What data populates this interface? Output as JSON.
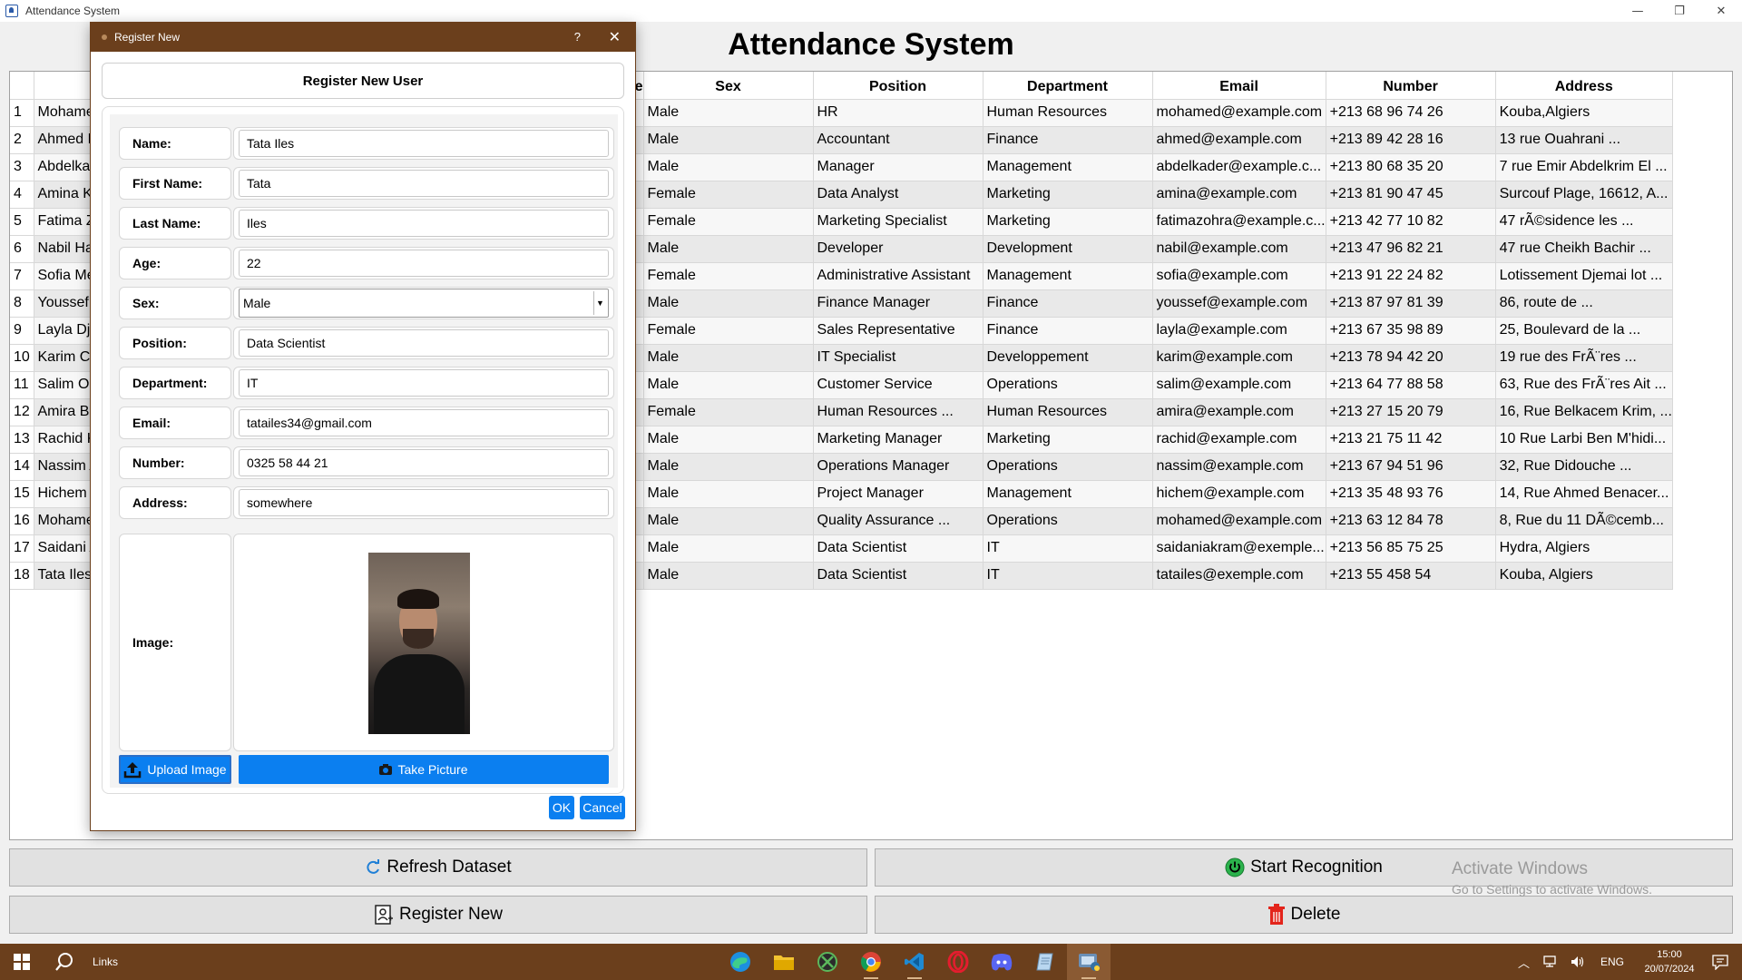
{
  "window": {
    "title": "Attendance System",
    "minimize": "—",
    "restore": "❐",
    "close": "✕"
  },
  "heading": "Attendance System",
  "table": {
    "columns": [
      "",
      "e",
      "Sex",
      "Position",
      "Department",
      "Email",
      "Number",
      "Address"
    ],
    "rows": [
      {
        "n": "1",
        "name": "Mohame",
        "sex": "Male",
        "position": "HR",
        "department": "Human Resources",
        "email": "mohamed@example.com",
        "number": "+213 68 96 74 26",
        "address": "Kouba,Algiers"
      },
      {
        "n": "2",
        "name": "Ahmed E",
        "sex": "Male",
        "position": "Accountant",
        "department": "Finance",
        "email": "ahmed@example.com",
        "number": "+213 89 42 28 16",
        "address": "13 rue Ouahrani ..."
      },
      {
        "n": "3",
        "name": "Abdelkac",
        "sex": "Male",
        "position": "Manager",
        "department": "Management",
        "email": "abdelkader@example.c...",
        "number": "+213 80 68 35 20",
        "address": "7 rue Emir Abdelkrim El ..."
      },
      {
        "n": "4",
        "name": "Amina K",
        "sex": "Female",
        "position": "Data Analyst",
        "department": "Marketing",
        "email": "amina@example.com",
        "number": "+213 81 90 47 45",
        "address": "Surcouf Plage, 16612, A..."
      },
      {
        "n": "5",
        "name": "Fatima Z",
        "sex": "Female",
        "position": "Marketing Specialist",
        "department": "Marketing",
        "email": "fatimazohra@example.c...",
        "number": "+213 42 77 10 82",
        "address": "47 rÃ©sidence les ..."
      },
      {
        "n": "6",
        "name": "Nabil Ha",
        "sex": "Male",
        "position": "Developer",
        "department": "Development",
        "email": "nabil@example.com",
        "number": "+213 47 96 82 21",
        "address": "47 rue Cheikh Bachir ..."
      },
      {
        "n": "7",
        "name": "Sofia Me",
        "sex": "Female",
        "position": "Administrative Assistant",
        "department": "Management",
        "email": "sofia@example.com",
        "number": "+213 91 22 24 82",
        "address": "Lotissement Djemai lot ..."
      },
      {
        "n": "8",
        "name": "Youssef I",
        "sex": "Male",
        "position": "Finance Manager",
        "department": "Finance",
        "email": "youssef@example.com",
        "number": "+213 87 97 81 39",
        "address": "86, route de ..."
      },
      {
        "n": "9",
        "name": "Layla Dje",
        "sex": "Female",
        "position": "Sales Representative",
        "department": "Finance",
        "email": "layla@example.com",
        "number": "+213 67 35 98 89",
        "address": "25, Boulevard de la ..."
      },
      {
        "n": "10",
        "name": "Karim Ch",
        "sex": "Male",
        "position": "IT Specialist",
        "department": "Developpement",
        "email": "karim@example.com",
        "number": "+213 78 94 42 20",
        "address": "19 rue des FrÃ¨res ..."
      },
      {
        "n": "11",
        "name": "Salim Ou",
        "sex": "Male",
        "position": "Customer Service",
        "department": "Operations",
        "email": "salim@example.com",
        "number": "+213 64 77 88 58",
        "address": "63, Rue des FrÃ¨res Ait ..."
      },
      {
        "n": "12",
        "name": "Amira Be",
        "sex": "Female",
        "position": "Human Resources ...",
        "department": "Human Resources",
        "email": "amira@example.com",
        "number": "+213 27 15 20 79",
        "address": "16, Rue Belkacem Krim, ..."
      },
      {
        "n": "13",
        "name": "Rachid K",
        "sex": "Male",
        "position": "Marketing Manager",
        "department": "Marketing",
        "email": "rachid@example.com",
        "number": "+213 21 75 11 42",
        "address": "10 Rue Larbi Ben M'hidi..."
      },
      {
        "n": "14",
        "name": "Nassim A",
        "sex": "Male",
        "position": "Operations Manager",
        "department": "Operations",
        "email": "nassim@example.com",
        "number": "+213 67 94 51 96",
        "address": "32, Rue Didouche ..."
      },
      {
        "n": "15",
        "name": "Hichem Z",
        "sex": "Male",
        "position": "Project Manager",
        "department": "Management",
        "email": "hichem@example.com",
        "number": "+213 35 48 93 76",
        "address": "14, Rue Ahmed Benacer..."
      },
      {
        "n": "16",
        "name": "Mohame",
        "sex": "Male",
        "position": "Quality Assurance ...",
        "department": "Operations",
        "email": "mohamed@example.com",
        "number": "+213 63 12 84 78",
        "address": "8, Rue du 11 DÃ©cemb..."
      },
      {
        "n": "17",
        "name": "Saidani A",
        "sex": "Male",
        "position": "Data Scientist",
        "department": "IT",
        "email": "saidaniakram@exemple...",
        "number": "+213 56 85 75 25",
        "address": "Hydra, Algiers"
      },
      {
        "n": "18",
        "name": "Tata Iles",
        "sex": "Male",
        "position": "Data Scientist",
        "department": "IT",
        "email": "tatailes@exemple.com",
        "number": "+213 55 458 54",
        "address": "Kouba, Algiers"
      }
    ]
  },
  "buttons": {
    "refresh": "Refresh Dataset",
    "start": "Start Recognition",
    "register": "Register New",
    "delete": "Delete"
  },
  "watermark": {
    "line1": "Activate Windows",
    "line2": "Go to Settings to activate Windows."
  },
  "dialog": {
    "title": "Register New",
    "help": "?",
    "close": "✕",
    "heading": "Register New User",
    "fields": {
      "name_label": "Name:",
      "name_value": "Tata Iles",
      "first_label": "First Name:",
      "first_value": "Tata",
      "last_label": "Last Name:",
      "last_value": "Iles",
      "age_label": "Age:",
      "age_value": "22",
      "sex_label": "Sex:",
      "sex_value": "Male",
      "position_label": "Position:",
      "position_value": "Data Scientist",
      "department_label": "Department:",
      "department_value": "IT",
      "email_label": "Email:",
      "email_value": "tatailes34@gmail.com",
      "number_label": "Number:",
      "number_value": "0325 58 44 21",
      "address_label": "Address:",
      "address_value": "somewhere",
      "image_label": "Image:"
    },
    "upload": "Upload Image",
    "take": "Take Picture",
    "ok": "OK",
    "cancel": "Cancel"
  },
  "taskbar": {
    "links": "Links",
    "lang": "ENG",
    "time": "15:00",
    "date": "20/07/2024"
  }
}
